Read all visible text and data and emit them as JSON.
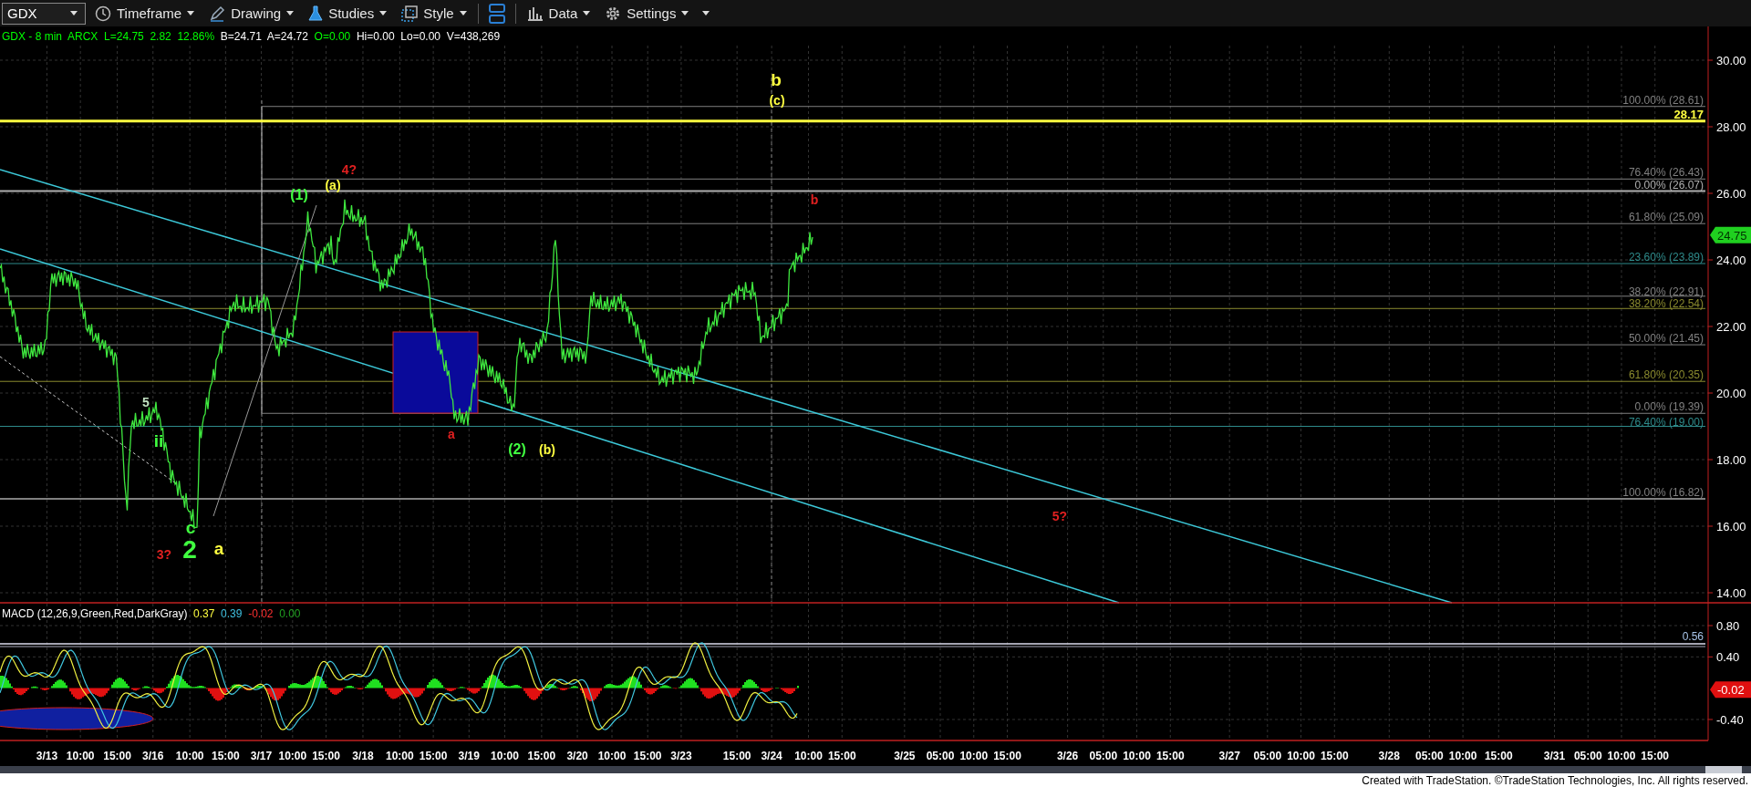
{
  "toolbar": {
    "symbol": "GDX",
    "items": [
      {
        "kind": "clock",
        "label": "Timeframe"
      },
      {
        "kind": "pen",
        "label": "Drawing"
      },
      {
        "kind": "flask",
        "label": "Studies"
      },
      {
        "kind": "style",
        "label": "Style"
      },
      {
        "kind": "layout"
      },
      {
        "kind": "data",
        "label": "Data"
      },
      {
        "kind": "gear",
        "label": "Settings"
      },
      {
        "kind": "caret"
      }
    ]
  },
  "info_line": [
    {
      "text": "GDX - 8 min  ARCX  L=24.75  2.82  12.86%",
      "color": "#00ff00"
    },
    {
      "text": "  B=24.71  A=24.72",
      "color": "#ffffff"
    },
    {
      "text": "  O=0.00",
      "color": "#00ff00"
    },
    {
      "text": "  Hi=0.00  Lo=0.00  V=438,269",
      "color": "#ffffff"
    }
  ],
  "fib_levels": [
    {
      "label": "100.00% (28.61)",
      "color": "#808080"
    },
    {
      "label": "28.17",
      "color": "#ffff40"
    },
    {
      "label": "76.40% (26.43)",
      "color": "#808080"
    },
    {
      "label": "0.00% (26.07)",
      "color": "#b0b0b0"
    },
    {
      "label": "61.80% (25.09)",
      "color": "#808080"
    },
    {
      "label": "23.60% (23.89)",
      "color": "#2e8b8b"
    },
    {
      "label": "38.20% (22.91)",
      "color": "#808080"
    },
    {
      "label": "38.20% (22.54)",
      "color": "#8b8b2e"
    },
    {
      "label": "50.00% (21.45)",
      "color": "#808080"
    },
    {
      "label": "61.80% (20.35)",
      "color": "#8b8b2e"
    },
    {
      "label": "0.00% (19.39)",
      "color": "#808080"
    },
    {
      "label": "76.40% (19.00)",
      "color": "#2e8b8b"
    },
    {
      "label": "100.00% (16.82)",
      "color": "#808080"
    }
  ],
  "wave_labels": [
    {
      "text": "b",
      "color": "#ffff40",
      "kind": "major"
    },
    {
      "text": "(c)",
      "color": "#ffff40",
      "kind": "small"
    },
    {
      "text": "4?",
      "color": "#e02020",
      "kind": "small"
    },
    {
      "text": "(a)",
      "color": "#ffff40",
      "kind": "small"
    },
    {
      "text": "(1)",
      "color": "#40ff40",
      "kind": "medium"
    },
    {
      "text": "b",
      "color": "#e02020",
      "kind": "small"
    },
    {
      "text": "a",
      "color": "#e02020",
      "kind": "small"
    },
    {
      "text": "(2)",
      "color": "#40ff40",
      "kind": "medium"
    },
    {
      "text": "(b)",
      "color": "#ffff40",
      "kind": "small"
    },
    {
      "text": "5?",
      "color": "#e02020",
      "kind": "small"
    },
    {
      "text": "5",
      "color": "#c0e0c0",
      "kind": "small"
    },
    {
      "text": "ii",
      "color": "#40ff40",
      "kind": "major"
    },
    {
      "text": "c",
      "color": "#40ff40",
      "kind": "major"
    },
    {
      "text": "3?",
      "color": "#e02020",
      "kind": "small"
    },
    {
      "text": "2",
      "color": "#40ff40",
      "kind": "huge"
    },
    {
      "text": "a",
      "color": "#ffff40",
      "kind": "major"
    }
  ],
  "price_axis": {
    "ticks": [
      "30.00",
      "28.00",
      "26.00",
      "24.00",
      "22.00",
      "20.00",
      "18.00",
      "16.00",
      "14.00"
    ],
    "last_price": "24.75"
  },
  "macd": {
    "legend": [
      {
        "text": "MACD (12,26,9,Green,Red,DarkGray)",
        "color": "#ffffff"
      },
      {
        "text": "  0.37",
        "color": "#ffff40"
      },
      {
        "text": "  0.39",
        "color": "#40c0e0"
      },
      {
        "text": "  -0.02",
        "color": "#ff3030"
      },
      {
        "text": "  0.00",
        "color": "#20a020"
      }
    ],
    "line_value": "0.56",
    "ticks": [
      "0.80",
      "0.40",
      "-0.40"
    ],
    "reading": "-0.02"
  },
  "time_axis": [
    "3/13",
    "10:00",
    "15:00",
    "3/16",
    "10:00",
    "15:00",
    "3/17",
    "10:00",
    "15:00",
    "3/18",
    "10:00",
    "15:00",
    "3/19",
    "10:00",
    "15:00",
    "3/20",
    "10:00",
    "15:00",
    "3/23",
    "15:00",
    "3/24",
    "10:00",
    "15:00",
    "3/25",
    "05:00",
    "10:00",
    "15:00",
    "3/26",
    "05:00",
    "10:00",
    "15:00",
    "3/27",
    "05:00",
    "10:00",
    "15:00",
    "3/28",
    "05:00",
    "10:00",
    "15:00",
    "3/31",
    "05:00",
    "10:00",
    "15:00"
  ],
  "footer": "Created with TradeStation. ©TradeStation Technologies, Inc. All rights reserved."
}
